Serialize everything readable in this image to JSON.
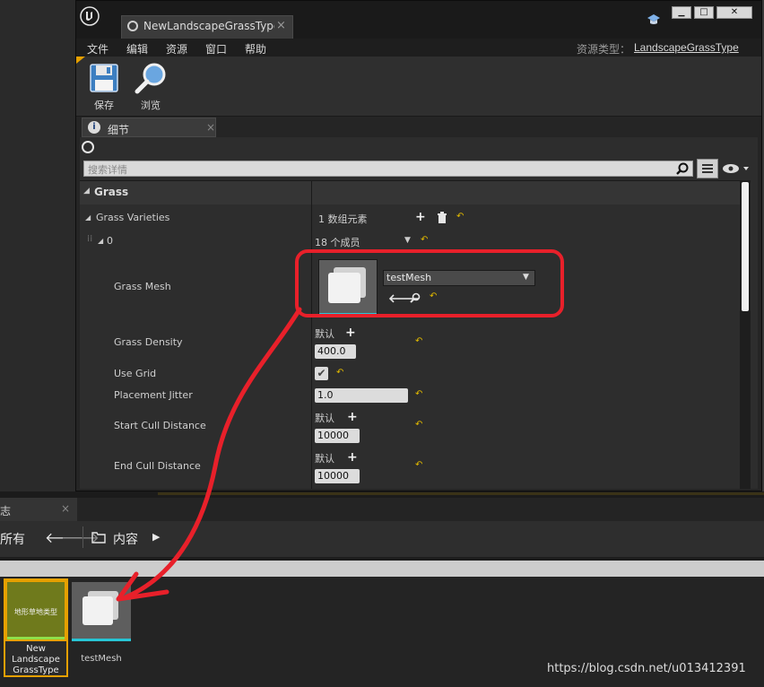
{
  "window": {
    "tab_title": "NewLandscapeGrassType",
    "tab_close": "×",
    "asset_type_label": "资源类型：",
    "asset_type_value": "LandscapeGrassType",
    "controls": {
      "min": "▁",
      "max": "□",
      "close": "✕"
    }
  },
  "menu": [
    "文件",
    "编辑",
    "资源",
    "窗口",
    "帮助"
  ],
  "toolbar": {
    "save_label": "保存",
    "browse_label": "浏览"
  },
  "details": {
    "tab_label": "细节",
    "tab_close": "×",
    "search_placeholder": "搜索详情",
    "category": "Grass",
    "varieties_label": "Grass Varieties",
    "varieties_value": "1 数组元素",
    "element_index": "0",
    "element_value": "18 个成员",
    "rows": {
      "grass_mesh": {
        "label": "Grass Mesh",
        "value": "testMesh"
      },
      "grass_density": {
        "label": "Grass Density",
        "default": "默认",
        "value": "400.0"
      },
      "use_grid": {
        "label": "Use Grid",
        "checked": true
      },
      "placement_jitter": {
        "label": "Placement Jitter",
        "value": "1.0"
      },
      "start_cull": {
        "label": "Start Cull Distance",
        "default": "默认",
        "value": "10000"
      },
      "end_cull": {
        "label": "End Cull Distance",
        "default": "默认",
        "value": "10000"
      }
    }
  },
  "content_browser": {
    "log_tab": "志",
    "filter_label": "所有",
    "path_label": "内容",
    "assets": [
      {
        "thumb_text": "地形草地类型",
        "name": "New Landscape GrassType"
      },
      {
        "name": "testMesh"
      }
    ]
  },
  "watermark": "https://blog.csdn.net/u013412391",
  "colors": {
    "annotation_red": "#e8202a",
    "accent_cyan": "#27c6d6",
    "grass_type_green": "#6f7a1c",
    "highlight_orange": "#e6a000"
  }
}
